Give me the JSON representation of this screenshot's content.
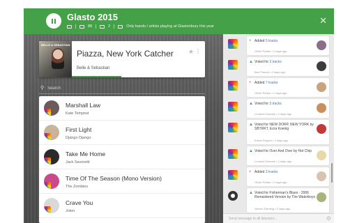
{
  "header": {
    "title": "Glasto 2015",
    "users_count": "88",
    "djs_count": "2",
    "description": "Only bands / artists playing at Glastonbury this year",
    "colors": {
      "accent": "#45a147",
      "feed_link": "#2e7cc4"
    }
  },
  "now_playing": {
    "title": "Piazza, New York Catcher",
    "artist": "Belle & Sebastian",
    "art_text": "BELLE & SEBASTIAN",
    "progress": 0.37
  },
  "search": {
    "placeholder": "Search"
  },
  "queue": [
    {
      "title": "Marshall Law",
      "artist": "Kate Tempest"
    },
    {
      "title": "First Light",
      "artist": "Django Django"
    },
    {
      "title": "Take Me Home",
      "artist": "Jack Savoretti"
    },
    {
      "title": "Time Of The Season (Mono Version)",
      "artist": "The Zombies"
    },
    {
      "title": "Crave You",
      "artist": "Jolen"
    }
  ],
  "feed": [
    {
      "action": "Added",
      "link": "5 tracks",
      "rest": "",
      "meta": "Oliver Parker • 2 days ago",
      "icon": "plus-icon"
    },
    {
      "action": "Voted for",
      "link": "3 tracks",
      "rest": "",
      "meta": "Ben Pearce • 2 days ago",
      "icon": "thumb-icon"
    },
    {
      "action": "Added",
      "link": "7 tracks",
      "rest": "",
      "meta": "Oliver Parker • 2 days ago",
      "icon": "plus-icon"
    },
    {
      "action": "Voted for",
      "link": "3 tracks",
      "rest": "",
      "meta": "Lorraine Durnam • 2 days ago",
      "icon": "thumb-icon"
    },
    {
      "action": "Voted for",
      "link": "",
      "rest": "NEW DORP, NEW YORK by SBTRKT, Ezra Koenig",
      "meta": "Edwin Rogers • 2 days ago",
      "icon": "thumb-icon"
    },
    {
      "action": "Voted for",
      "link": "",
      "rest": "Over And Over by Hot Chip",
      "meta": "Lorraine Durnam • 2 days ago",
      "icon": "thumb-icon"
    },
    {
      "action": "Added",
      "link": "3 tracks",
      "rest": "",
      "meta": "Oliver Parker • 2 days ago",
      "icon": "plus-icon"
    },
    {
      "action": "Voted for",
      "link": "",
      "rest": "Fisherman's Blues - 2006 Remastered Version by The Waterboys",
      "meta": "Steven Farming • 2 days ago",
      "icon": "thumb-icon"
    }
  ],
  "chat": {
    "placeholder": "Send message to all listeners..."
  }
}
